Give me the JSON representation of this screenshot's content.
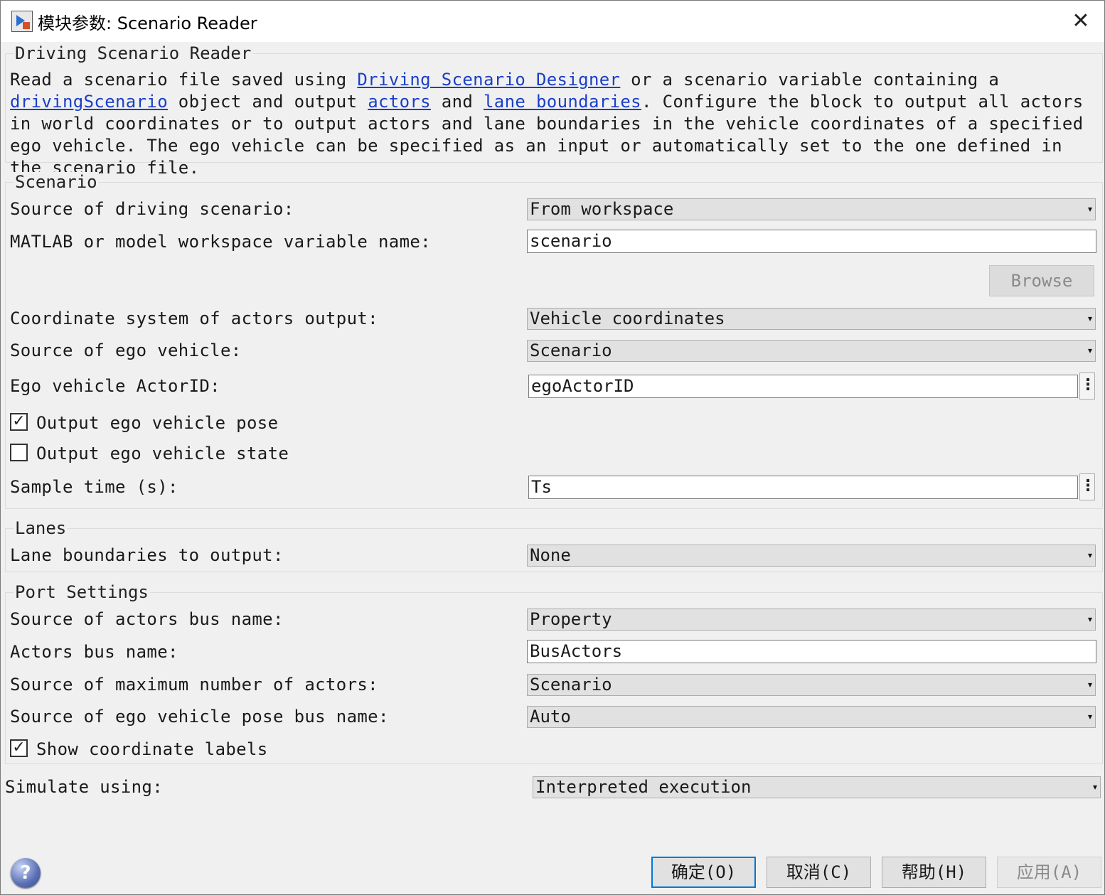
{
  "window": {
    "title": "模块参数: Scenario Reader",
    "close_glyph": "✕"
  },
  "block": {
    "name": "Driving Scenario Reader",
    "desc_parts": [
      "Read a scenario file saved using ",
      "Driving Scenario Designer",
      " or a scenario variable containing a ",
      "drivingScenario",
      " object and output ",
      "actors",
      " and ",
      "lane boundaries",
      ". Configure the block to output all actors in world coordinates or to output actors and lane boundaries in the vehicle coordinates of a specified ego vehicle. The ego vehicle can be specified as an input or automatically set to the one defined in the scenario file."
    ]
  },
  "scenario": {
    "title": "Scenario",
    "source_label": "Source of driving scenario:",
    "source_value": "From workspace",
    "varname_label": "MATLAB or model workspace variable name:",
    "varname_value": "scenario",
    "browse_label": "Browse",
    "coord_label": "Coordinate system of actors output:",
    "coord_value": "Vehicle coordinates",
    "ego_source_label": "Source of ego vehicle:",
    "ego_source_value": "Scenario",
    "ego_id_label": "Ego vehicle ActorID:",
    "ego_id_value": "egoActorID",
    "output_pose_label": "Output ego vehicle pose",
    "output_pose_checked": true,
    "output_state_label": "Output ego vehicle state",
    "output_state_checked": false,
    "sample_time_label": "Sample time (s):",
    "sample_time_value": "Ts"
  },
  "lanes": {
    "title": "Lanes",
    "boundaries_label": "Lane boundaries to output:",
    "boundaries_value": "None"
  },
  "ports": {
    "title": "Port Settings",
    "bus_source_label": "Source of actors bus name:",
    "bus_source_value": "Property",
    "bus_name_label": "Actors bus name:",
    "bus_name_value": "BusActors",
    "max_actors_label": "Source of maximum number of actors:",
    "max_actors_value": "Scenario",
    "pose_bus_label": "Source of ego vehicle pose bus name:",
    "pose_bus_value": "Auto",
    "coord_labels_label": "Show coordinate labels",
    "coord_labels_checked": true
  },
  "simulate": {
    "label": "Simulate using:",
    "value": "Interpreted execution"
  },
  "buttons": {
    "ok": "确定(O)",
    "cancel": "取消(C)",
    "help": "帮助(H)",
    "apply": "应用(A)"
  },
  "icons": {
    "dropdown": "▾",
    "more": "⋮",
    "check": "✓",
    "help": "?"
  }
}
